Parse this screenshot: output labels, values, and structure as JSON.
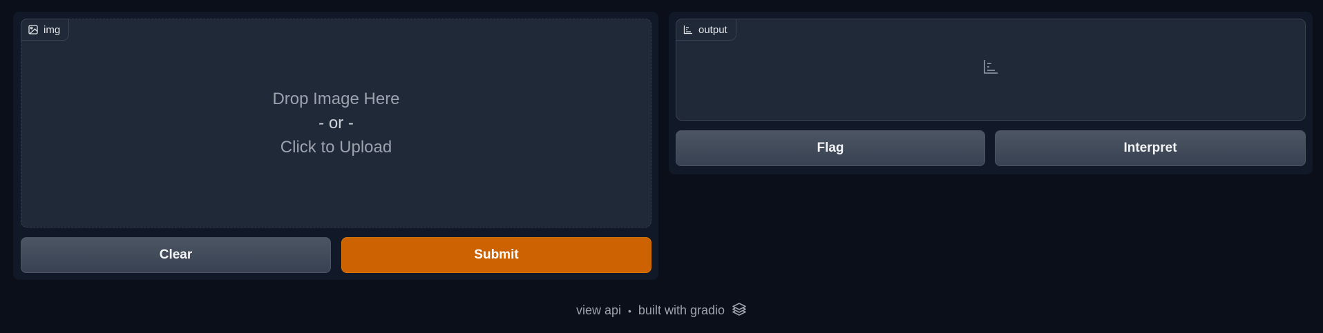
{
  "input": {
    "label": "img",
    "icon": "image-icon",
    "drop_line1": "Drop Image Here",
    "drop_or": "- or -",
    "drop_line2": "Click to Upload"
  },
  "output": {
    "label": "output",
    "icon": "bar-chart-icon"
  },
  "buttons": {
    "clear": "Clear",
    "submit": "Submit",
    "flag": "Flag",
    "interpret": "Interpret"
  },
  "footer": {
    "view_api": "view api",
    "separator": "•",
    "built_with": "built with gradio",
    "logo_icon": "gradio-logo-icon"
  },
  "colors": {
    "background": "#0b0f19",
    "panel": "#111827",
    "block": "#1f2937",
    "submit": "#cd6203"
  }
}
